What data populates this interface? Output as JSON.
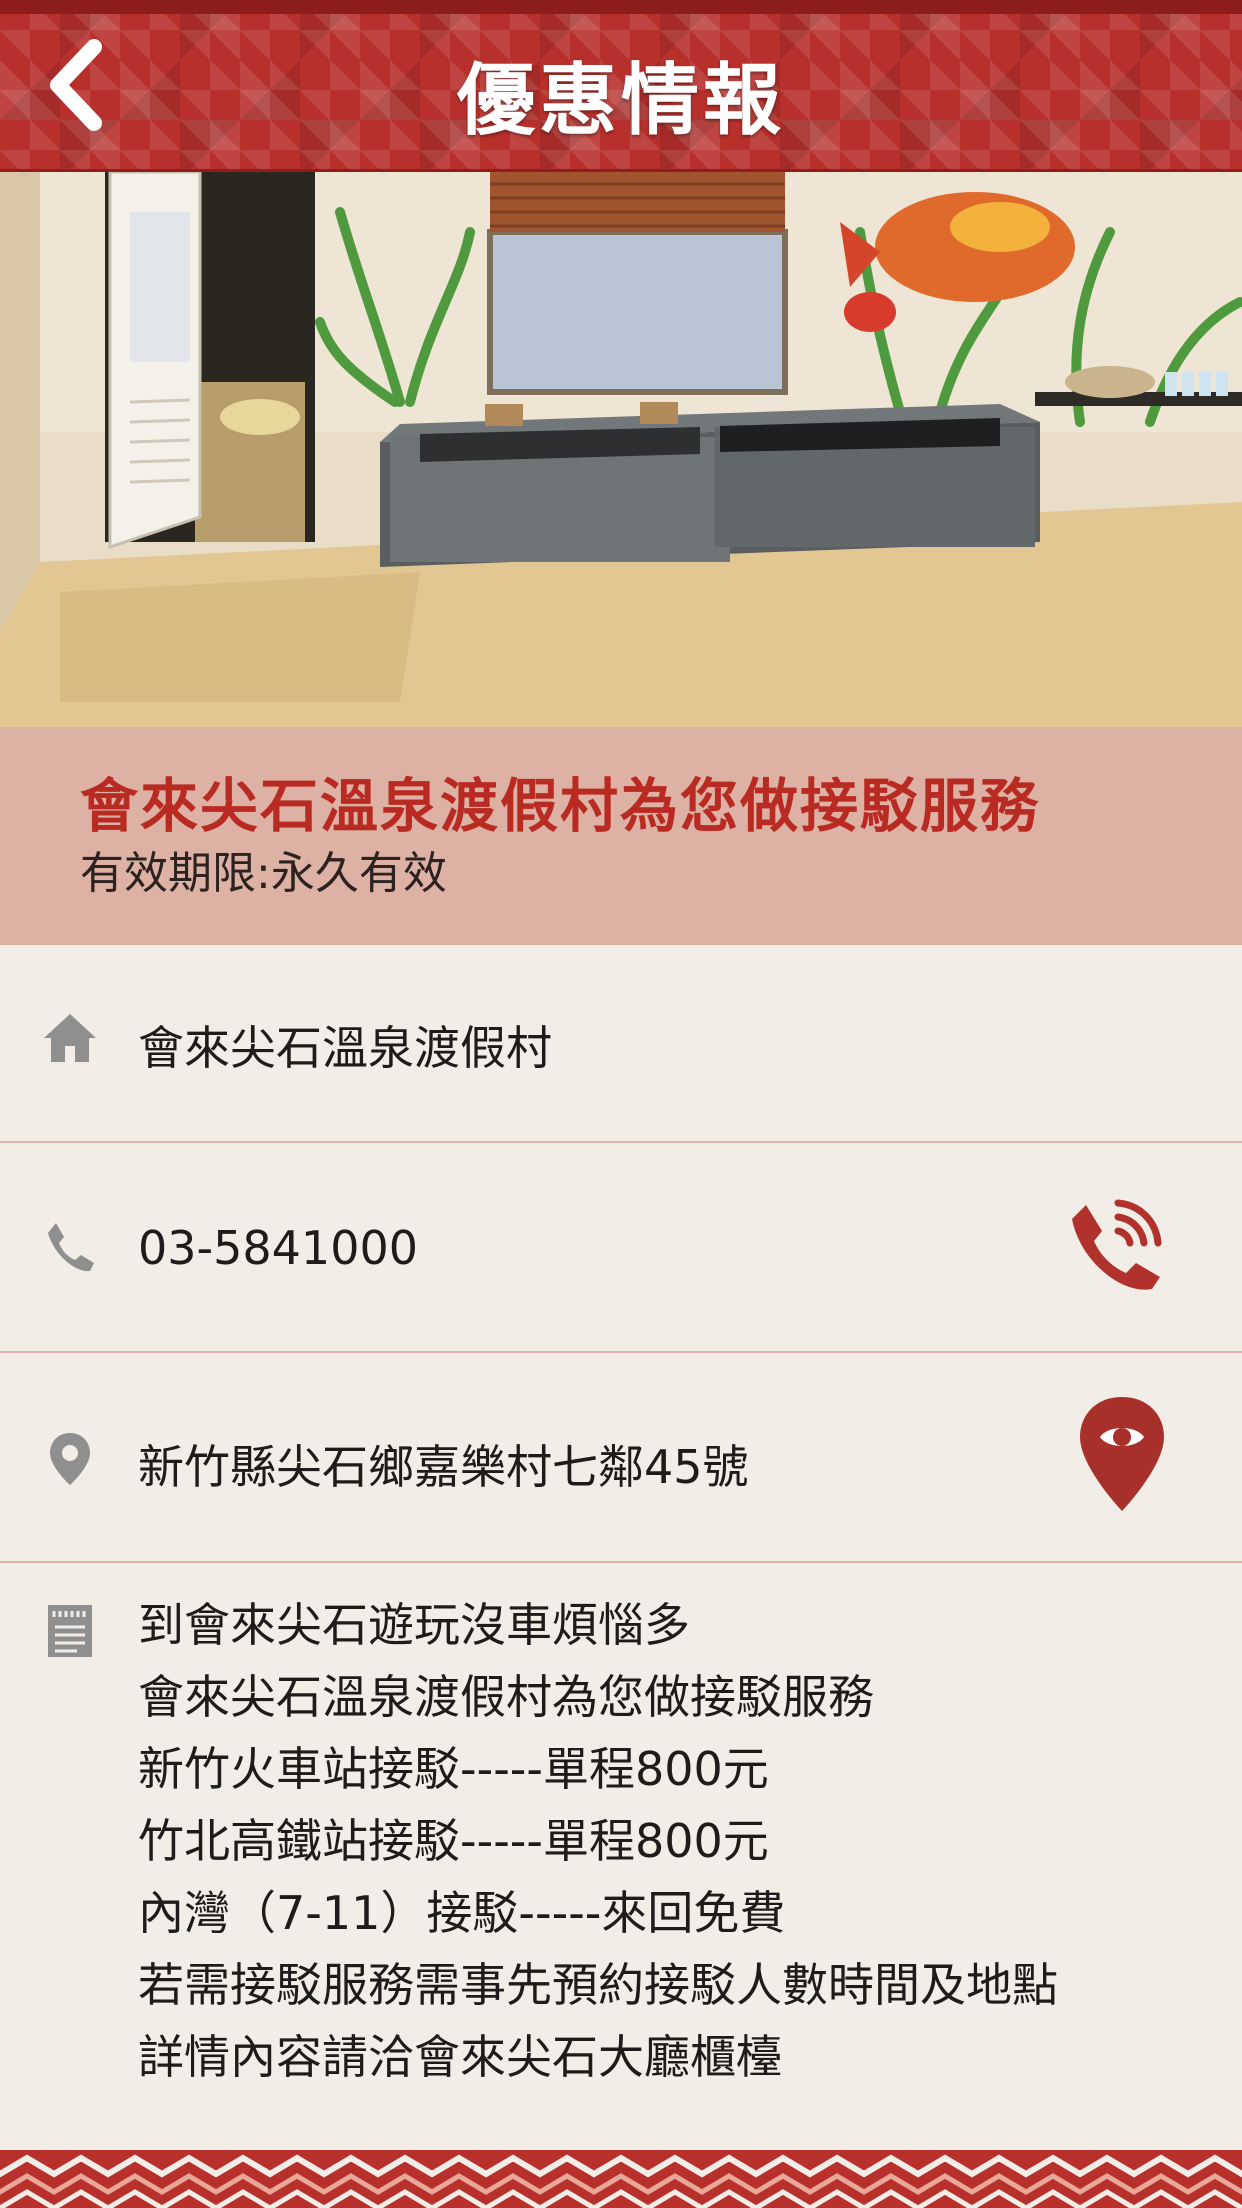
{
  "header": {
    "title": "優惠情報",
    "back_icon": "chevron-left-icon"
  },
  "offer": {
    "title": "會來尖石溫泉渡假村為您做接駁服務",
    "validity": "有效期限:永久有效"
  },
  "details": {
    "venue": {
      "icon": "home-icon",
      "text": "會來尖石溫泉渡假村"
    },
    "phone": {
      "icon": "phone-icon",
      "text": "03-5841000",
      "action_icon": "call-icon"
    },
    "address": {
      "icon": "location-pin-icon",
      "text": "新竹縣尖石鄉嘉樂村七鄰45號",
      "action_icon": "map-view-icon"
    },
    "description": {
      "icon": "document-icon",
      "lines": [
        "到會來尖石遊玩沒車煩惱多",
        "會來尖石溫泉渡假村為您做接駁服務",
        "新竹火車站接駁-----單程800元",
        "竹北高鐵站接駁-----單程800元",
        "內灣（7-11）接駁-----來回免費",
        "若需接駁服務需事先預約接駁人數時間及地點",
        "詳情內容請洽會來尖石大廳櫃檯"
      ]
    }
  },
  "colors": {
    "accent": "#b8302c",
    "band": "#ddb1a3",
    "background": "#f3ede7",
    "icon_grey": "#8f8f8f"
  }
}
